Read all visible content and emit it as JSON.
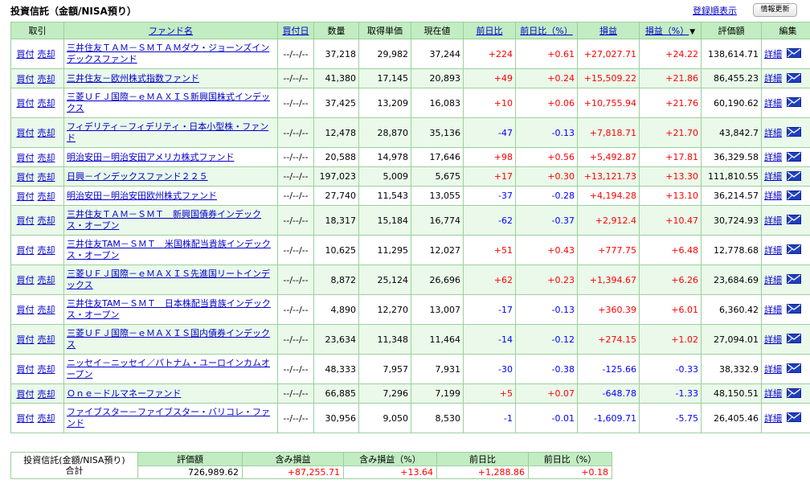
{
  "header": {
    "title": "投資信託（金額/NISA預り）",
    "register_order_link": "登録順表示",
    "refresh_button": "情報更新"
  },
  "columns": {
    "trade": "取引",
    "fund_name": "ファンド名",
    "buy_date": "買付日",
    "quantity": "数量",
    "unit_cost": "取得単価",
    "current_price": "現在値",
    "day_change": "前日比",
    "day_change_pct": "前日比（%）",
    "profit_loss": "損益",
    "profit_loss_pct": "損益（%）",
    "sort_marker": "▼",
    "valuation": "評価額",
    "edit": "編集"
  },
  "labels": {
    "buy": "買付",
    "sell": "売却",
    "detail": "詳細"
  },
  "funds": [
    {
      "name": "三井住友ＴＡＭ－ＳＭＴＡＭダウ・ジョーンズインデックスファンド",
      "date": "--/--/--",
      "qty": "37,218",
      "cost": "29,982",
      "price": "37,244",
      "chg": "+224",
      "chg_pct": "+0.61",
      "pl": "+27,027.71",
      "pl_pct": "+24.22",
      "value": "138,614.71"
    },
    {
      "name": "三井住友－欧州株式指数ファンド",
      "date": "--/--/--",
      "qty": "41,380",
      "cost": "17,145",
      "price": "20,893",
      "chg": "+49",
      "chg_pct": "+0.24",
      "pl": "+15,509.22",
      "pl_pct": "+21.86",
      "value": "86,455.23"
    },
    {
      "name": "三菱ＵＦＪ国際－ｅＭＡＸＩＳ新興国株式インデックス",
      "date": "--/--/--",
      "qty": "37,425",
      "cost": "13,209",
      "price": "16,083",
      "chg": "+10",
      "chg_pct": "+0.06",
      "pl": "+10,755.94",
      "pl_pct": "+21.76",
      "value": "60,190.62"
    },
    {
      "name": "フィデリティ－フィデリティ・日本小型株・ファンド",
      "date": "--/--/--",
      "qty": "12,478",
      "cost": "28,870",
      "price": "35,136",
      "chg": "-47",
      "chg_pct": "-0.13",
      "pl": "+7,818.71",
      "pl_pct": "+21.70",
      "value": "43,842.7"
    },
    {
      "name": "明治安田－明治安田アメリカ株式ファンド",
      "date": "--/--/--",
      "qty": "20,588",
      "cost": "14,978",
      "price": "17,646",
      "chg": "+98",
      "chg_pct": "+0.56",
      "pl": "+5,492.87",
      "pl_pct": "+17.81",
      "value": "36,329.58"
    },
    {
      "name": "日興－インデックスファンド２２５",
      "date": "--/--/--",
      "qty": "197,023",
      "cost": "5,009",
      "price": "5,675",
      "chg": "+17",
      "chg_pct": "+0.30",
      "pl": "+13,121.73",
      "pl_pct": "+13.30",
      "value": "111,810.55"
    },
    {
      "name": "明治安田－明治安田欧州株式ファンド",
      "date": "--/--/--",
      "qty": "27,740",
      "cost": "11,543",
      "price": "13,055",
      "chg": "-37",
      "chg_pct": "-0.28",
      "pl": "+4,194.28",
      "pl_pct": "+13.10",
      "value": "36,214.57"
    },
    {
      "name": "三井住友ＴＡＭ－ＳＭＴ　新興国債券インデックス・オープン",
      "date": "--/--/--",
      "qty": "18,317",
      "cost": "15,184",
      "price": "16,774",
      "chg": "-62",
      "chg_pct": "-0.37",
      "pl": "+2,912.4",
      "pl_pct": "+10.47",
      "value": "30,724.93"
    },
    {
      "name": "三井住友TAM－ＳＭＴ　米国株配当貴族インデックス・オープン",
      "date": "--/--/--",
      "qty": "10,625",
      "cost": "11,295",
      "price": "12,027",
      "chg": "+51",
      "chg_pct": "+0.43",
      "pl": "+777.75",
      "pl_pct": "+6.48",
      "value": "12,778.68"
    },
    {
      "name": "三菱ＵＦＪ国際－ｅＭＡＸＩＳ先進国リートインデックス",
      "date": "--/--/--",
      "qty": "8,872",
      "cost": "25,124",
      "price": "26,696",
      "chg": "+62",
      "chg_pct": "+0.23",
      "pl": "+1,394.67",
      "pl_pct": "+6.26",
      "value": "23,684.69"
    },
    {
      "name": "三井住友TAM－ＳＭＴ　日本株配当貴族インデックス・オープン",
      "date": "--/--/--",
      "qty": "4,890",
      "cost": "12,270",
      "price": "13,007",
      "chg": "-17",
      "chg_pct": "-0.13",
      "pl": "+360.39",
      "pl_pct": "+6.01",
      "value": "6,360.42"
    },
    {
      "name": "三菱ＵＦＪ国際－ｅＭＡＸＩＳ国内債券インデックス",
      "date": "--/--/--",
      "qty": "23,634",
      "cost": "11,348",
      "price": "11,464",
      "chg": "-14",
      "chg_pct": "-0.12",
      "pl": "+274.15",
      "pl_pct": "+1.02",
      "value": "27,094.01"
    },
    {
      "name": "ニッセイ－ニッセイ／パトナム・ユーロインカムオープン",
      "date": "--/--/--",
      "qty": "48,333",
      "cost": "7,957",
      "price": "7,931",
      "chg": "-30",
      "chg_pct": "-0.38",
      "pl": "-125.66",
      "pl_pct": "-0.33",
      "value": "38,332.9"
    },
    {
      "name": "Ｏｎｅ－ドルマネーファンド",
      "date": "--/--/--",
      "qty": "66,885",
      "cost": "7,296",
      "price": "7,199",
      "chg": "+5",
      "chg_pct": "+0.07",
      "pl": "-648.78",
      "pl_pct": "-1.33",
      "value": "48,150.51"
    },
    {
      "name": "ファイブスター－ファイブスター・バリコレ・ファンド",
      "date": "--/--/--",
      "qty": "30,956",
      "cost": "9,050",
      "price": "8,530",
      "chg": "-1",
      "chg_pct": "-0.01",
      "pl": "-1,609.71",
      "pl_pct": "-5.75",
      "value": "26,405.46"
    }
  ],
  "summary": {
    "label_line1": "投資信託(金額/NISA預り)",
    "label_line2": "合計",
    "headers": [
      "評価額",
      "含み損益",
      "含み損益（%）",
      "前日比",
      "前日比（%）"
    ],
    "values": [
      "726,989.62",
      "+87,255.71",
      "+13.64",
      "+1,288.86",
      "+0.18"
    ]
  },
  "colors": {
    "header_bg": "#c2ecc2",
    "row_alt_bg": "#eaf9ea",
    "border": "#9bd09b",
    "positive": "#ff0000",
    "negative": "#0000ff",
    "link": "#0000cc"
  }
}
